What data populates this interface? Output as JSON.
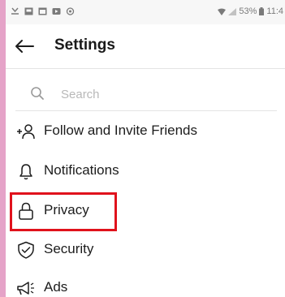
{
  "status_bar": {
    "icons": [
      "download-icon",
      "image-icon",
      "app-icon",
      "video-icon",
      "camera-icon"
    ],
    "battery": "53%",
    "time": "11:4"
  },
  "header": {
    "title": "Settings"
  },
  "search": {
    "placeholder": "Search"
  },
  "menu": {
    "items": [
      {
        "label": "Follow and Invite Friends",
        "icon": "add-person-icon"
      },
      {
        "label": "Notifications",
        "icon": "bell-icon"
      },
      {
        "label": "Privacy",
        "icon": "lock-icon"
      },
      {
        "label": "Security",
        "icon": "shield-icon"
      },
      {
        "label": "Ads",
        "icon": "megaphone-icon"
      }
    ]
  },
  "highlight_color": "#e0121c",
  "background_color": "#e5a3c8"
}
